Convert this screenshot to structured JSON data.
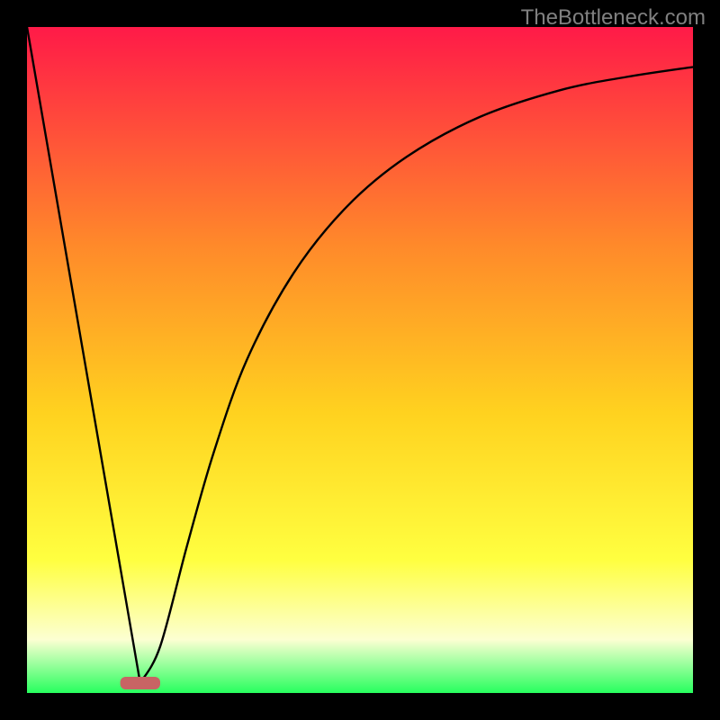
{
  "watermark": "TheBottleneck.com",
  "colors": {
    "frame": "#000000",
    "grad_top": "#ff1a48",
    "grad_mid1": "#ff8a2a",
    "grad_mid2": "#ffd21f",
    "grad_lower": "#ffff40",
    "grad_bottom": "#fcffd2",
    "grad_green": "#27ff5e",
    "curve": "#000000",
    "marker": "#c86464"
  },
  "chart_data": {
    "type": "line",
    "title": "",
    "xlabel": "",
    "ylabel": "",
    "x_range": [
      0,
      100
    ],
    "y_range": [
      0,
      100
    ],
    "marker_x_range": [
      14,
      20
    ],
    "series": [
      {
        "name": "bottleneck-curve",
        "points": [
          {
            "x": 0,
            "y": 100
          },
          {
            "x": 17,
            "y": 1.5
          },
          {
            "x": 20,
            "y": 7
          },
          {
            "x": 24,
            "y": 22
          },
          {
            "x": 28,
            "y": 36
          },
          {
            "x": 33,
            "y": 50
          },
          {
            "x": 40,
            "y": 63
          },
          {
            "x": 48,
            "y": 73
          },
          {
            "x": 57,
            "y": 80.5
          },
          {
            "x": 68,
            "y": 86.5
          },
          {
            "x": 80,
            "y": 90.5
          },
          {
            "x": 90,
            "y": 92.5
          },
          {
            "x": 100,
            "y": 94
          }
        ]
      }
    ]
  }
}
